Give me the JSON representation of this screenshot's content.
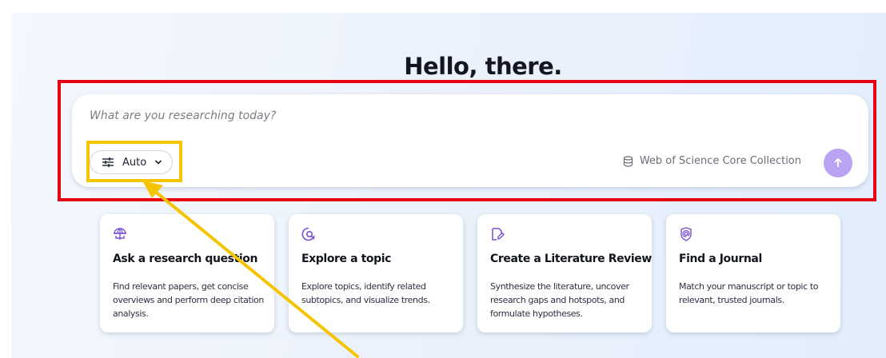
{
  "greeting": "Hello, there.",
  "search": {
    "placeholder": "What are you researching today?",
    "mode_label": "Auto",
    "collection_label": "Web of Science Core Collection"
  },
  "cards": [
    {
      "icon": "globe-icon",
      "title": "Ask a research question",
      "description": "Find relevant papers, get concise overviews and perform deep citation analysis."
    },
    {
      "icon": "search-topic-icon",
      "title": "Explore a topic",
      "description": "Explore topics, identify related subtopics, and visualize trends."
    },
    {
      "icon": "document-edit-icon",
      "title": "Create a Literature Review",
      "description": "Synthesize the literature, uncover research gaps and hotspots, and formulate hypotheses."
    },
    {
      "icon": "journal-at-icon",
      "title": "Find a Journal",
      "description": "Match your manuscript or topic to relevant, trusted journals."
    }
  ],
  "colors": {
    "accent": "#7b4fd6",
    "send_button": "#b9a3f2",
    "highlight_red": "#e60012",
    "highlight_yellow": "#f5c400"
  }
}
